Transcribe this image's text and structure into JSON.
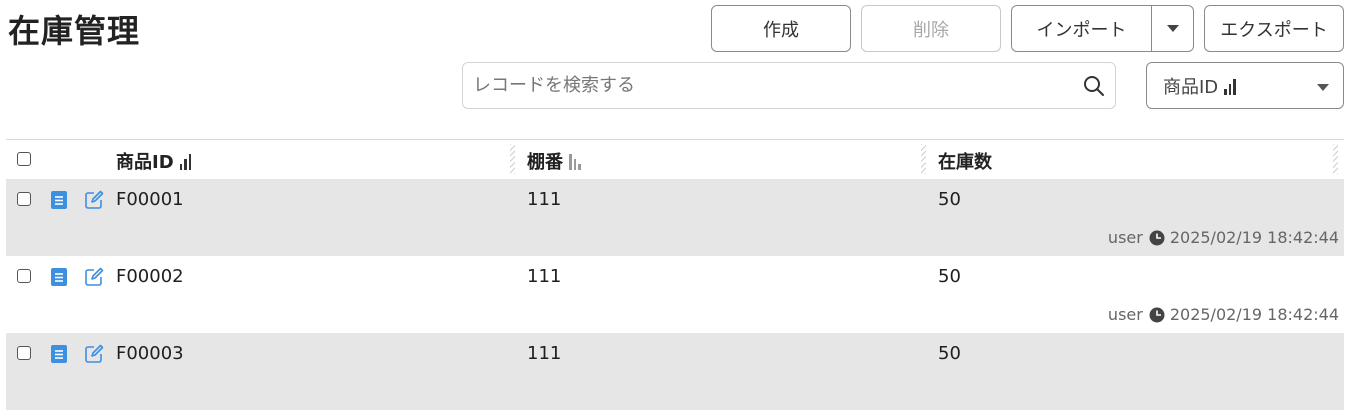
{
  "header": {
    "title": "在庫管理"
  },
  "toolbar": {
    "create_label": "作成",
    "delete_label": "削除",
    "import_label": "インポート",
    "export_label": "エクスポート"
  },
  "search": {
    "placeholder": "レコードを検索する",
    "value": ""
  },
  "sort": {
    "selected": "商品ID"
  },
  "table": {
    "columns": [
      "商品ID",
      "棚番",
      "在庫数"
    ],
    "rows": [
      {
        "product_id": "F00001",
        "shelf": "111",
        "stock": "50",
        "user": "user",
        "timestamp": "2025/02/19 18:42:44"
      },
      {
        "product_id": "F00002",
        "shelf": "111",
        "stock": "50",
        "user": "user",
        "timestamp": "2025/02/19 18:42:44"
      },
      {
        "product_id": "F00003",
        "shelf": "111",
        "stock": "50",
        "user": "",
        "timestamp": ""
      }
    ]
  },
  "colors": {
    "accent_icon": "#3d8fe0",
    "row_shade": "#e6e6e6",
    "border": "#8a8a8a"
  },
  "icons": [
    "search-icon",
    "chevron-down-icon",
    "sort-bars-icon",
    "document-icon",
    "edit-icon",
    "clock-icon"
  ]
}
